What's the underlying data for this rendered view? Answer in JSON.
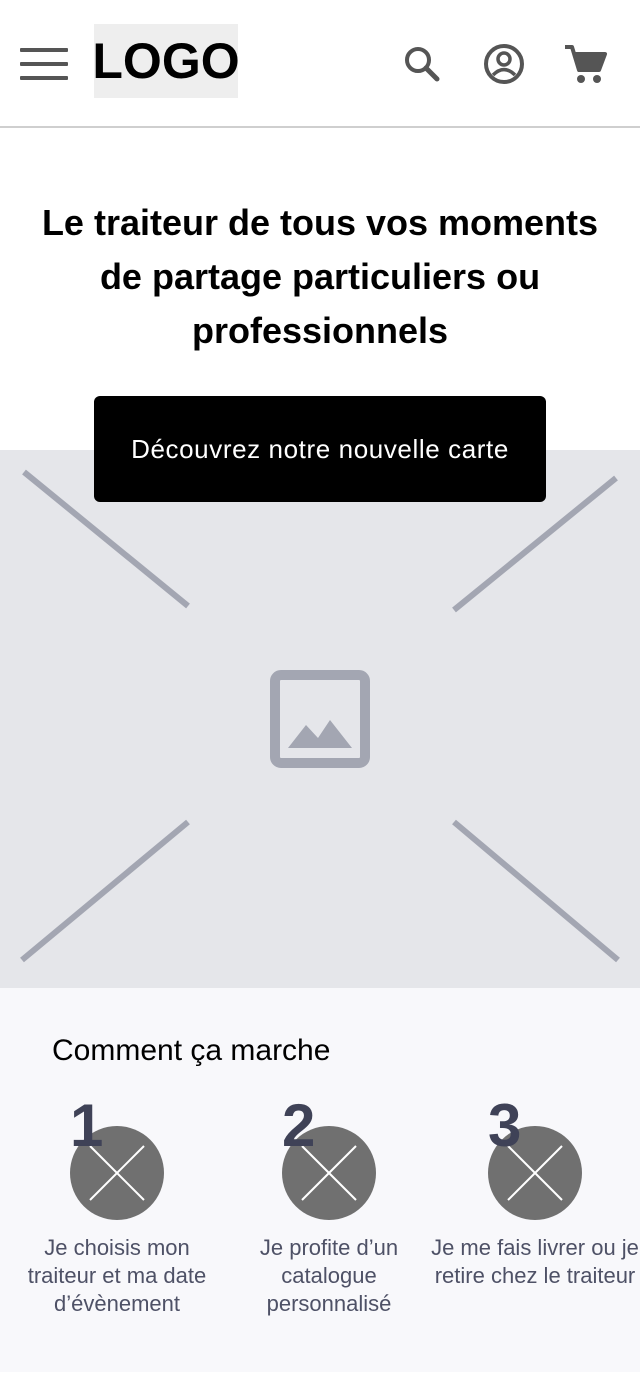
{
  "header": {
    "logo": "LOGO",
    "icons": [
      "menu-icon",
      "search-icon",
      "account-icon",
      "cart-icon"
    ]
  },
  "hero": {
    "title": "Le traiteur de tous vos moments de partage particuliers ou professionnels",
    "cta_label": "Découvrez notre nouvelle carte",
    "image_icon": "image-placeholder-icon"
  },
  "how_it_works": {
    "title": "Comment ça marche",
    "steps": [
      {
        "number": "1",
        "text": "Je choisis mon traiteur et ma date d’évènement"
      },
      {
        "number": "2",
        "text": "Je profite d’un catalogue personnalisé"
      },
      {
        "number": "3",
        "text": "Je me fais livrer ou je retire chez le traiteur"
      }
    ]
  },
  "colors": {
    "cta_background": "#000000",
    "placeholder_background": "#e5e6ea",
    "placeholder_lines": "#a3a6b2",
    "step_number": "#3f4257",
    "step_circle": "#707070",
    "step_text": "#4e5166"
  }
}
